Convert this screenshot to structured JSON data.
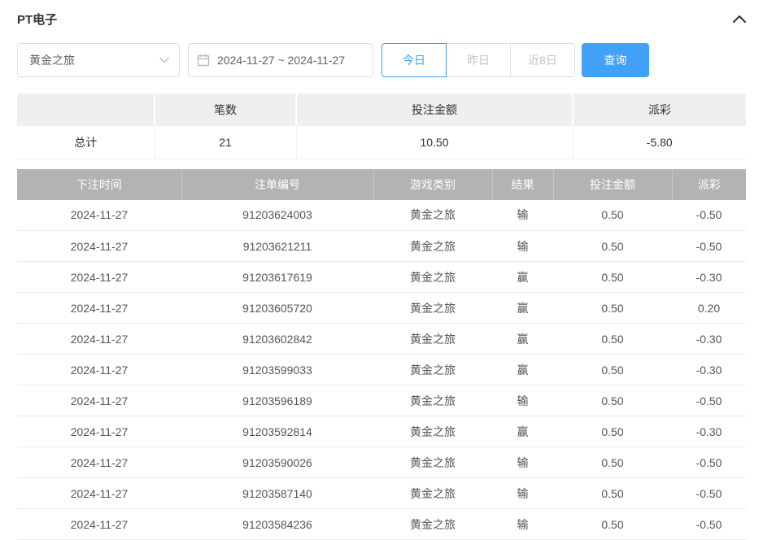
{
  "panel": {
    "title": "PT电子"
  },
  "filters": {
    "game_select": {
      "value": "黄金之旅"
    },
    "date_range": {
      "value": "2024-11-27 ~ 2024-11-27"
    },
    "quick_ranges": [
      {
        "label": "今日",
        "active": true
      },
      {
        "label": "昨日",
        "active": false
      },
      {
        "label": "近8日",
        "active": false
      }
    ],
    "search_label": "查询"
  },
  "summary": {
    "columns": [
      "",
      "笔数",
      "投注金额",
      "派彩"
    ],
    "total_label": "总计",
    "count": "21",
    "bet_amount": "10.50",
    "payout": "-5.80"
  },
  "table": {
    "columns": [
      "下注时间",
      "注单编号",
      "游戏类别",
      "结果",
      "投注金额",
      "派彩"
    ],
    "rows": [
      [
        "2024-11-27",
        "91203624003",
        "黄金之旅",
        "输",
        "0.50",
        "-0.50"
      ],
      [
        "2024-11-27",
        "91203621211",
        "黄金之旅",
        "输",
        "0.50",
        "-0.50"
      ],
      [
        "2024-11-27",
        "91203617619",
        "黄金之旅",
        "赢",
        "0.50",
        "-0.30"
      ],
      [
        "2024-11-27",
        "91203605720",
        "黄金之旅",
        "赢",
        "0.50",
        "0.20"
      ],
      [
        "2024-11-27",
        "91203602842",
        "黄金之旅",
        "赢",
        "0.50",
        "-0.30"
      ],
      [
        "2024-11-27",
        "91203599033",
        "黄金之旅",
        "赢",
        "0.50",
        "-0.30"
      ],
      [
        "2024-11-27",
        "91203596189",
        "黄金之旅",
        "输",
        "0.50",
        "-0.50"
      ],
      [
        "2024-11-27",
        "91203592814",
        "黄金之旅",
        "赢",
        "0.50",
        "-0.30"
      ],
      [
        "2024-11-27",
        "91203590026",
        "黄金之旅",
        "输",
        "0.50",
        "-0.50"
      ],
      [
        "2024-11-27",
        "91203587140",
        "黄金之旅",
        "输",
        "0.50",
        "-0.50"
      ],
      [
        "2024-11-27",
        "91203584236",
        "黄金之旅",
        "输",
        "0.50",
        "-0.50"
      ]
    ]
  },
  "colors": {
    "accent": "#41a1f8",
    "negative": "#e25a5a",
    "table_header": "#b3b3b3"
  }
}
